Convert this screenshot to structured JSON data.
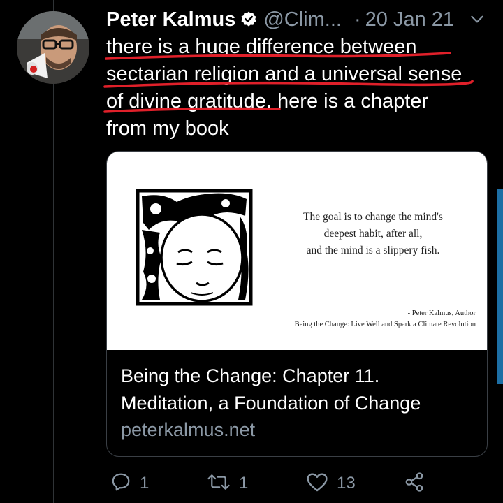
{
  "tweet": {
    "author_name": "Peter Kalmus",
    "handle": "@Clim...",
    "separator": "·",
    "date": "20 Jan 21",
    "text_segments": [
      "there is a huge difference between",
      "sectarian religion and a universal sense",
      "of divine gratitude.",
      " here is a chapter",
      "from my book"
    ]
  },
  "card": {
    "quote_lines": [
      "The goal is to change the mind's",
      "deepest habit, after all,",
      "and the mind is a slippery fish."
    ],
    "attribution_author": "- Peter Kalmus, Author",
    "attribution_book": "Being the Change: Live Well and Spark a Climate Revolution",
    "title_line1": "Being the Change: Chapter 11.",
    "title_line2": "Meditation, a Foundation of Change",
    "domain": "peterkalmus.net"
  },
  "actions": {
    "reply_count": "1",
    "retweet_count": "1",
    "like_count": "13"
  },
  "icons": {
    "verified": "verified-badge-icon",
    "menu": "chevron-down-icon",
    "reply": "reply-icon",
    "retweet": "retweet-icon",
    "like": "heart-icon",
    "share": "share-icon"
  },
  "colors": {
    "background": "#000000",
    "text": "#ffffff",
    "secondary_text": "#8b98a5",
    "annotation_underline": "#e0202a",
    "accent_scrollbar": "#1d6fa5"
  }
}
